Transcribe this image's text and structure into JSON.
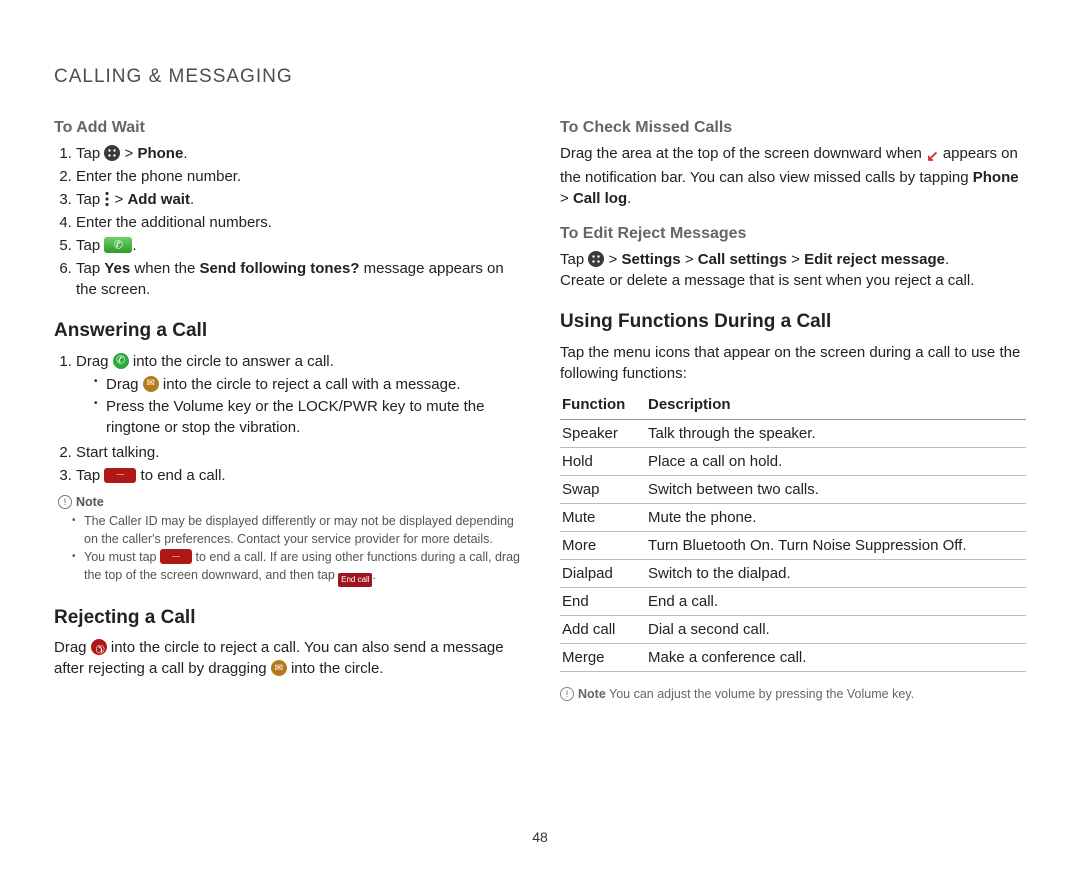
{
  "chapter": "CALLING & MESSAGING",
  "page_number": "48",
  "left": {
    "add_wait_heading": "To Add Wait",
    "add_wait": {
      "s1a": "Tap ",
      "s1b": " > ",
      "s1c": "Phone",
      "s1d": ".",
      "s2": "Enter the phone number.",
      "s3a": "Tap ",
      "s3b": " > ",
      "s3c": "Add wait",
      "s3d": ".",
      "s4": "Enter the additional numbers.",
      "s5a": "Tap ",
      "s5b": ".",
      "s6a": "Tap ",
      "s6b": "Yes",
      "s6c": " when the ",
      "s6d": "Send following tones?",
      "s6e": " message appears on the screen."
    },
    "answer_heading": "Answering a Call",
    "answer": {
      "s1a": "Drag ",
      "s1b": " into the circle to answer a call.",
      "b1a": "Drag ",
      "b1b": " into the circle to reject a call with a message.",
      "b2": "Press the Volume key or the LOCK/PWR key to mute the ringtone or stop the vibration.",
      "s2": "Start talking.",
      "s3a": "Tap ",
      "s3b": " to end a call."
    },
    "note_label": "Note",
    "notes": {
      "n1": "The Caller ID may be displayed differently or may not be displayed depending on the caller's preferences. Contact your service provider for more details.",
      "n2a": "You must tap ",
      "n2b": " to end a call. If are using other functions during a call, drag the top of the screen downward, and then tap ",
      "endcall_label": "End call"
    },
    "reject_heading": "Rejecting a Call",
    "reject": {
      "p1a": "Drag ",
      "p1b": " into the circle to reject a call. You can also send a message after rejecting a call by dragging ",
      "p1c": " into the circle."
    }
  },
  "right": {
    "missed_heading": "To Check Missed Calls",
    "missed": {
      "p1a": "Drag the area at the top of the screen downward when ",
      "p1b": " appears on the notification bar. You can also view missed calls by tapping ",
      "p1c": "Phone",
      "p1d": " > ",
      "p1e": "Call log",
      "p1f": "."
    },
    "edit_heading": "To Edit Reject Messages",
    "edit": {
      "p1a": "Tap ",
      "p1b": " > ",
      "p1c": "Settings",
      "p1d": " > ",
      "p1e": "Call settings",
      "p1f": " > ",
      "p1g": "Edit reject message",
      "p1h": ".",
      "p2": "Create or delete a message that is sent when you reject a call."
    },
    "during_heading": "Using Functions During a Call",
    "during_intro": "Tap the menu icons that appear on the screen during a call to use the following functions:",
    "table": {
      "col_function": "Function",
      "col_description": "Description",
      "rows": [
        {
          "fn": "Speaker",
          "desc": "Talk through the speaker."
        },
        {
          "fn": "Hold",
          "desc": "Place a call on hold."
        },
        {
          "fn": "Swap",
          "desc": "Switch between two calls."
        },
        {
          "fn": "Mute",
          "desc": "Mute the phone."
        },
        {
          "fn": "More",
          "desc": "Turn Bluetooth On. Turn Noise Suppression Off."
        },
        {
          "fn": "Dialpad",
          "desc": "Switch to the dialpad."
        },
        {
          "fn": "End",
          "desc": "End a call."
        },
        {
          "fn": "Add call",
          "desc": "Dial a second call."
        },
        {
          "fn": "Merge",
          "desc": "Make a conference call."
        }
      ]
    },
    "note2_label": "Note",
    "note2_text": " You can adjust the volume by pressing the Volume key."
  }
}
